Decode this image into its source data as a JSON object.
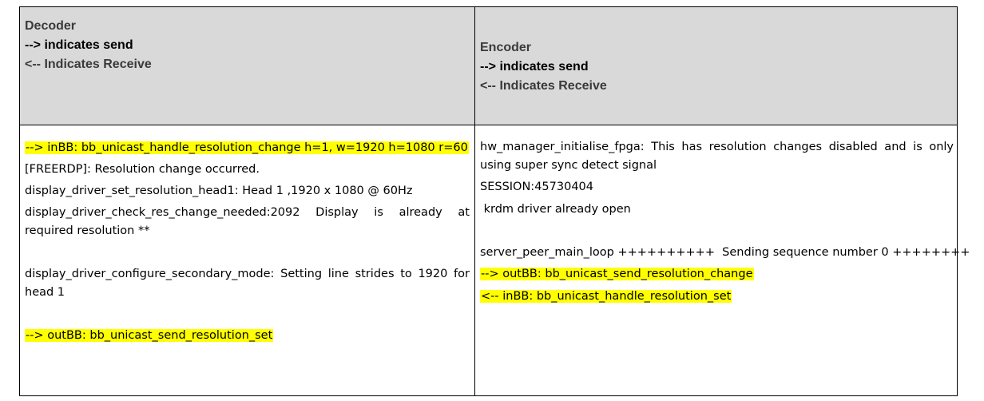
{
  "decoder": {
    "header": {
      "title": "Decoder",
      "send_legend": "--> indicates send",
      "receive_legend": "<-- Indicates Receive"
    },
    "lines": {
      "l1": "--> inBB: bb_unicast_handle_resolution_change h=1, w=1920 h=1080 r=60",
      "l2": "[FREERDP]: Resolution change occurred.",
      "l3": "display_driver_set_resolution_head1: Head 1 ,1920 x 1080 @ 60Hz",
      "l4a": "display_driver_check_res_change_needed:2092 Display is already at",
      "l4b": "required resolution **",
      "l5a": "display_driver_configure_secondary_mode: Setting line strides to 1920 for",
      "l5b": "head 1",
      "l6": "--> outBB: bb_unicast_send_resolution_set"
    }
  },
  "encoder": {
    "header": {
      "title": "Encoder",
      "send_legend": "--> indicates send",
      "receive_legend": "<-- Indicates Receive"
    },
    "lines": {
      "l1a": "hw_manager_initialise_fpga: This has resolution changes disabled and is only",
      "l1b": "using super sync detect signal",
      "l2": "SESSION:45730404",
      "l3": " krdm driver already open",
      "l4": "server_peer_main_loop ++++++++++  Sending sequence number 0 ++++++++",
      "l5": "--> outBB: bb_unicast_send_resolution_change",
      "l6": "<-- inBB: bb_unicast_handle_resolution_set"
    }
  },
  "colors": {
    "highlight": "#ffff00",
    "header_background": "#d9d9d9"
  }
}
